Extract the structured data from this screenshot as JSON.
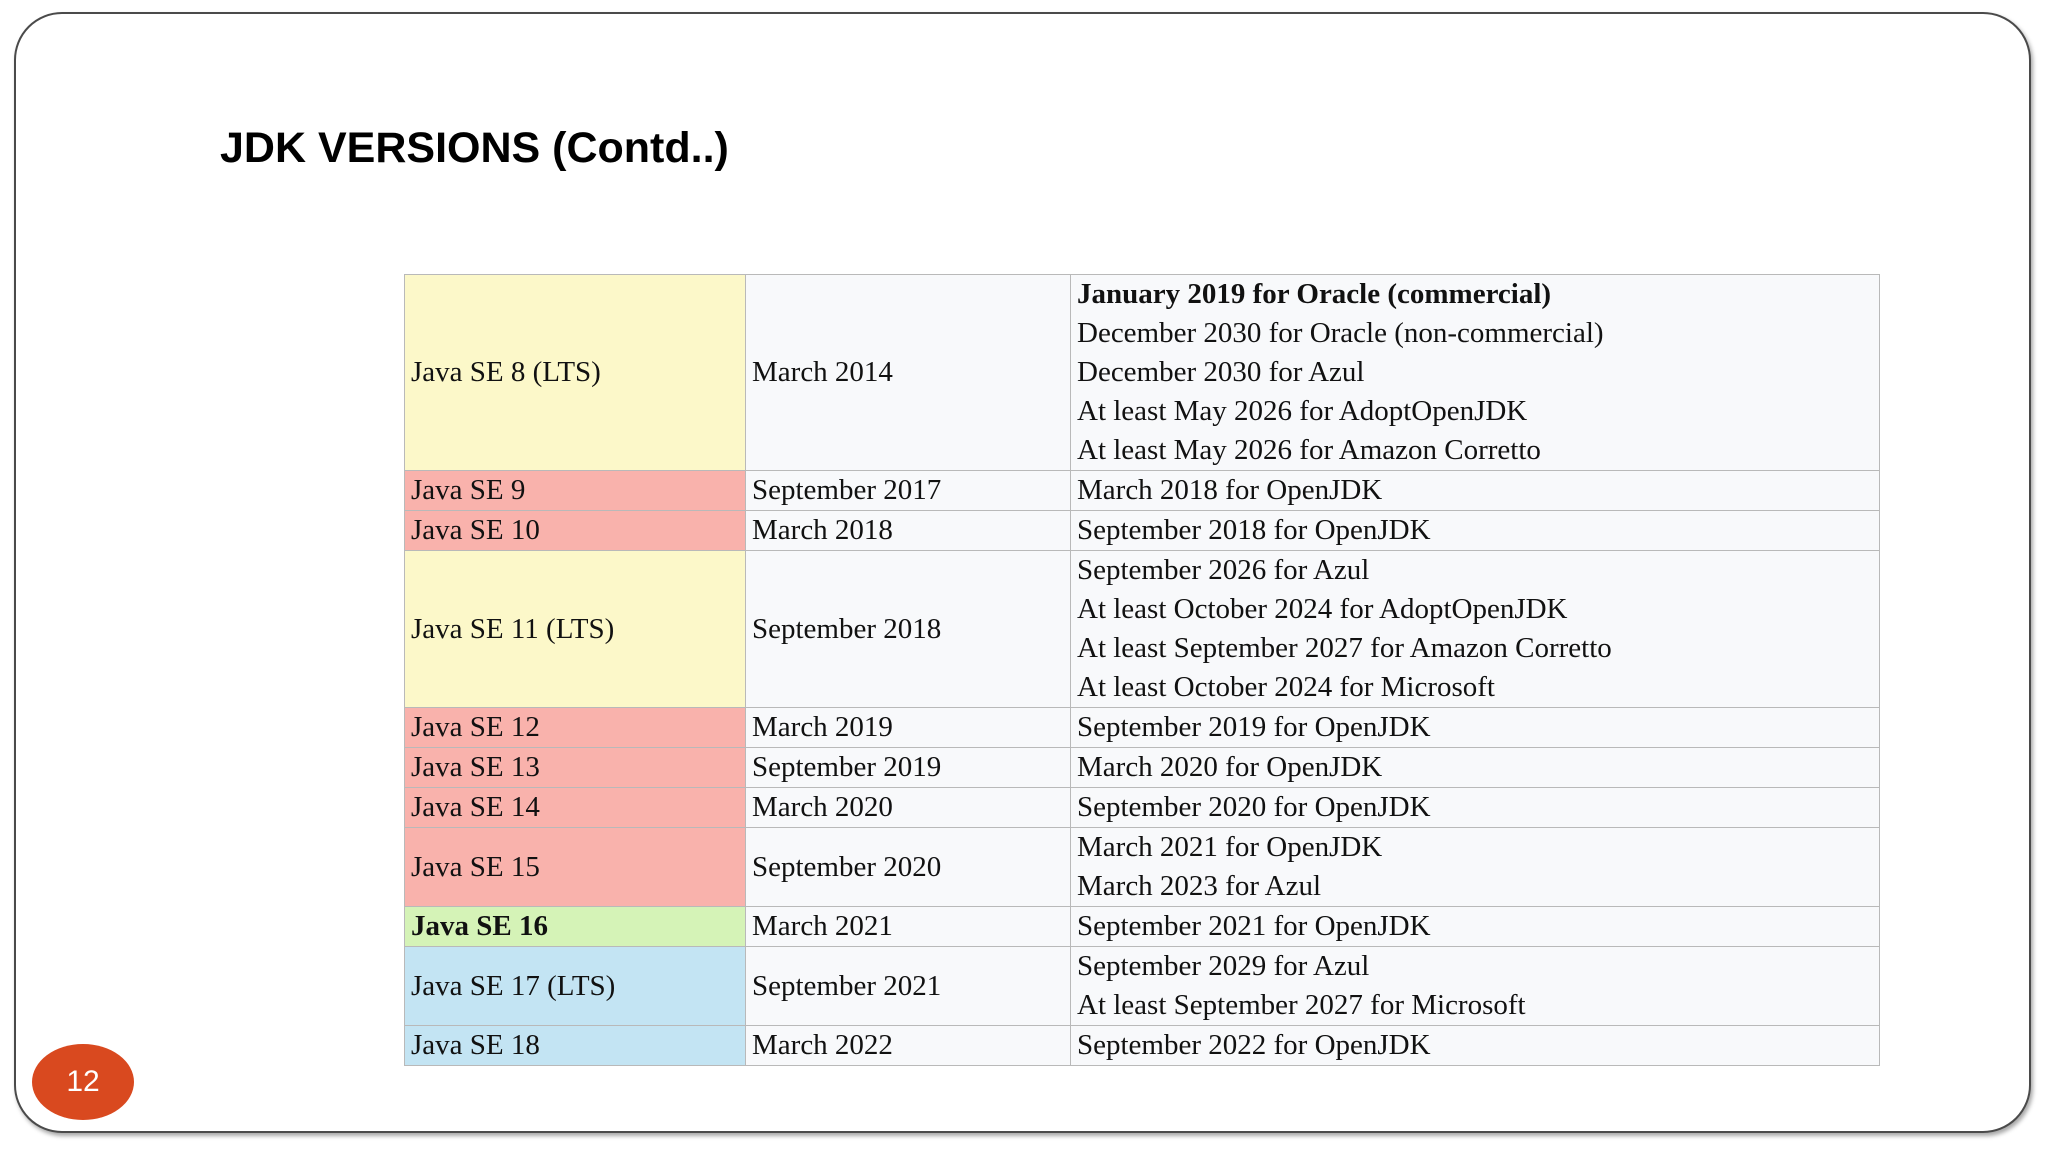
{
  "slide": {
    "title": "JDK VERSIONS (Contd..)",
    "page_number": "12"
  },
  "colors": {
    "lts": "#fcf8c9",
    "end_of_life": "#f9b2ac",
    "current": "#d5f3b7",
    "upcoming": "#c3e4f3",
    "badge": "#d9491f"
  },
  "table": {
    "rows": [
      {
        "version": "Java SE 8 (LTS)",
        "release": "March 2014",
        "support": [
          {
            "text": "January 2019 for Oracle (commercial)",
            "bold": true
          },
          {
            "text": "December 2030 for Oracle (non-commercial)"
          },
          {
            "text": "December 2030 for Azul"
          },
          {
            "text": "At least May 2026 for AdoptOpenJDK"
          },
          {
            "text": "At least May 2026 for Amazon Corretto"
          }
        ],
        "status": "lts"
      },
      {
        "version": "Java SE 9",
        "release": "September 2017",
        "support": [
          {
            "text": "March 2018 for OpenJDK"
          }
        ],
        "status": "eol"
      },
      {
        "version": "Java SE 10",
        "release": "March 2018",
        "support": [
          {
            "text": "September 2018 for OpenJDK"
          }
        ],
        "status": "eol"
      },
      {
        "version": "Java SE 11 (LTS)",
        "release": "September 2018",
        "support": [
          {
            "text": "September 2026 for Azul"
          },
          {
            "text": "At least October 2024 for AdoptOpenJDK"
          },
          {
            "text": "At least September 2027 for Amazon Corretto"
          },
          {
            "text": "At least October 2024 for Microsoft"
          }
        ],
        "status": "lts"
      },
      {
        "version": "Java SE 12",
        "release": "March 2019",
        "support": [
          {
            "text": "September 2019 for OpenJDK"
          }
        ],
        "status": "eol"
      },
      {
        "version": "Java SE 13",
        "release": "September 2019",
        "support": [
          {
            "text": "March 2020 for OpenJDK"
          }
        ],
        "status": "eol"
      },
      {
        "version": "Java SE 14",
        "release": "March 2020",
        "support": [
          {
            "text": "September 2020 for OpenJDK"
          }
        ],
        "status": "eol"
      },
      {
        "version": "Java SE 15",
        "release": "September 2020",
        "support": [
          {
            "text": "March 2021 for OpenJDK"
          },
          {
            "text": "March 2023 for Azul"
          }
        ],
        "status": "eol"
      },
      {
        "version": "Java SE 16",
        "release": "March 2021",
        "support": [
          {
            "text": "September 2021 for OpenJDK"
          }
        ],
        "status": "cur"
      },
      {
        "version": "Java SE 17 (LTS)",
        "release": "September 2021",
        "support": [
          {
            "text": "September 2029 for Azul"
          },
          {
            "text": "At least September 2027 for Microsoft"
          }
        ],
        "status": "next"
      },
      {
        "version": "Java SE 18",
        "release": "March 2022",
        "support": [
          {
            "text": "September 2022 for OpenJDK"
          }
        ],
        "status": "next"
      }
    ]
  }
}
